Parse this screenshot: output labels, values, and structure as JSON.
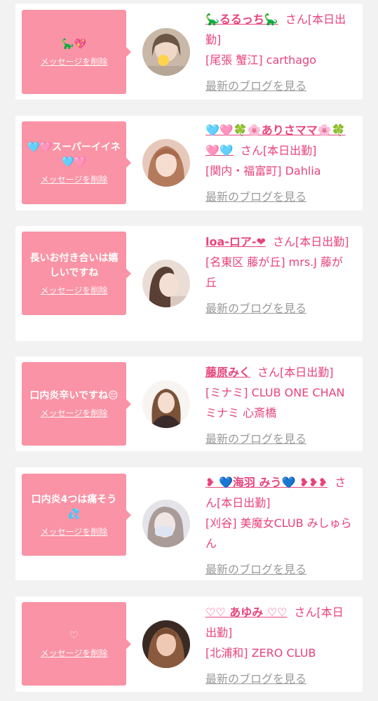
{
  "common": {
    "delete_label": "メッセージを削除",
    "blog_label": "最新のブログを見る",
    "san_label": "さん",
    "status_label": "[本日出勤]"
  },
  "colors": {
    "background": "#f2f2f2",
    "card": "#ffffff",
    "bubble": "#f993a5",
    "accent_text": "#e8437a",
    "link_gray": "#9a9a9a"
  },
  "entries": [
    {
      "message": "🦕💖",
      "name": "🦕るるっち🦕",
      "shop": "[尾張 蟹江] carthago",
      "avatar_icon": "girl-photo-avatar"
    },
    {
      "message": "🩵🩷スーパーイイネ🩵🩷",
      "name": "🩵🩷🍀🌸ありさママ🌸🍀🩷🩵",
      "shop": "[関内・福富町] Dahlia",
      "avatar_icon": "girl-photo-avatar"
    },
    {
      "message": "長いお付き合いは嬉しいですね",
      "name": "loa-ロア-❤",
      "shop": "[名東区 藤が丘] mrs.J 藤が丘",
      "avatar_icon": "girl-photo-avatar"
    },
    {
      "message": "口内炎辛いですね😔",
      "name": "藤原みく",
      "shop": "[ミナミ] CLUB ONE CHAN ミナミ 心斎橋",
      "avatar_icon": "girl-photo-avatar"
    },
    {
      "message": "口内炎4つは痛そう💦",
      "name": "❥ 💙海羽 みう💙 ❥❥❥",
      "shop": "[刈谷] 美魔女CLUB みしゅらん",
      "avatar_icon": "girl-photo-avatar"
    },
    {
      "message": "♡",
      "name": "♡♡ あゆみ ♡♡",
      "shop": "[北浦和] ZERO CLUB",
      "avatar_icon": "girl-photo-avatar"
    }
  ]
}
